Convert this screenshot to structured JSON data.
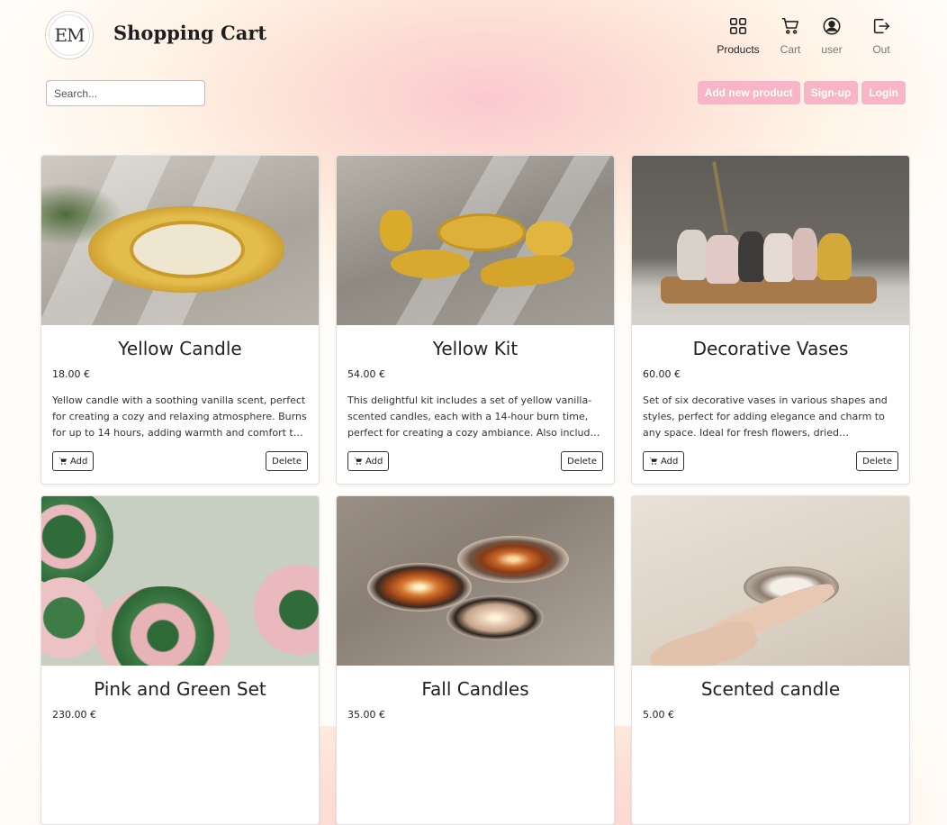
{
  "header": {
    "logo_text": "EM",
    "title": "Shopping Cart"
  },
  "nav": [
    {
      "label": "Products",
      "icon": "grid-icon"
    },
    {
      "label": "Cart",
      "icon": "cart-icon"
    },
    {
      "label": "user",
      "icon": "user-icon"
    },
    {
      "label": "Out",
      "icon": "logout-icon"
    }
  ],
  "search": {
    "placeholder": "Search..."
  },
  "actions": {
    "add_product": "Add new product",
    "signup": "Sign-up",
    "login": "Login"
  },
  "card_buttons": {
    "add": "Add",
    "delete": "Delete"
  },
  "products": [
    {
      "name": "Yellow Candle",
      "price": "18.00 €",
      "description": "Yellow candle with a soothing vanilla scent, perfect for creating a cozy and relaxing atmosphere. Burns for up to 14 hours, adding warmth and comfort to any space."
    },
    {
      "name": "Yellow Kit",
      "price": "54.00 €",
      "description": "This delightful kit includes a set of yellow vanilla-scented candles, each with a 14-hour burn time, perfect for creating a cozy ambiance. Also included are matching decorative pieces."
    },
    {
      "name": "Decorative Vases",
      "price": "60.00 €",
      "description": "Set of six decorative vases in various shapes and styles, perfect for adding elegance and charm to any space. Ideal for fresh flowers, dried arrangements, or display."
    },
    {
      "name": "Pink and Green Set",
      "price": "230.00 €",
      "description": ""
    },
    {
      "name": "Fall Candles",
      "price": "35.00 €",
      "description": ""
    },
    {
      "name": "Scented candle",
      "price": "5.00 €",
      "description": ""
    }
  ],
  "colors": {
    "accent": "#f9b5c8",
    "search_border": "#e7a7b6"
  }
}
